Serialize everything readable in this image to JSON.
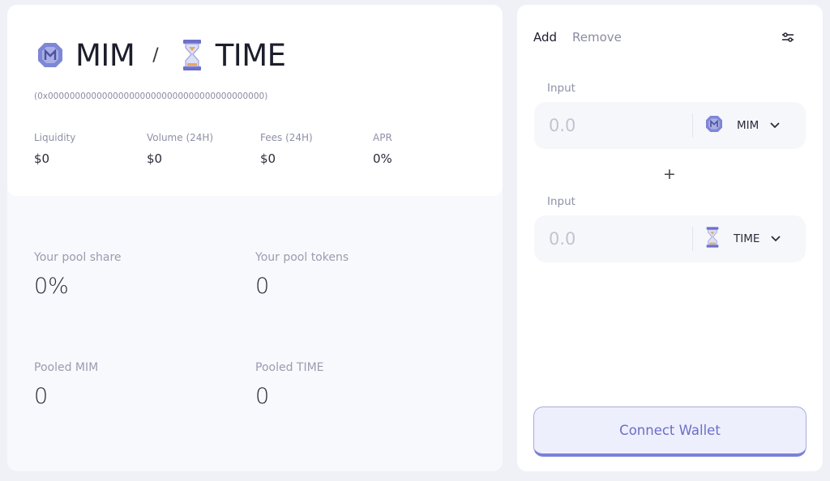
{
  "pair": {
    "token_a": "MIM",
    "separator": "/",
    "token_b": "TIME",
    "address": "(0x0000000000000000000000000000000000000000)"
  },
  "stats": [
    {
      "label": "Liquidity",
      "value": "$0"
    },
    {
      "label": "Volume (24H)",
      "value": "$0"
    },
    {
      "label": "Fees (24H)",
      "value": "$0"
    },
    {
      "label": "APR",
      "value": "0%"
    }
  ],
  "pool": {
    "share_label": "Your pool share",
    "share_value": "0%",
    "tokens_label": "Your pool tokens",
    "tokens_value": "0",
    "pooled_a_label": "Pooled MIM",
    "pooled_a_value": "0",
    "pooled_b_label": "Pooled TIME",
    "pooled_b_value": "0"
  },
  "tabs": {
    "add": "Add",
    "remove": "Remove"
  },
  "inputs": [
    {
      "label": "Input",
      "placeholder": "0.0",
      "token": "MIM",
      "icon": "mim-token-icon"
    },
    {
      "label": "Input",
      "placeholder": "0.0",
      "token": "TIME",
      "icon": "time-token-icon"
    }
  ],
  "plus_symbol": "+",
  "connect_button": "Connect Wallet",
  "colors": {
    "accent": "#7b80d8",
    "button_text": "#6a6fc5",
    "background": "#f0f1f7"
  }
}
